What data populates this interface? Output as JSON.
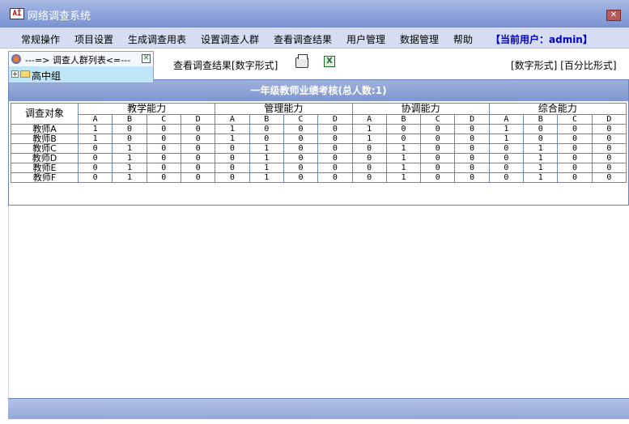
{
  "window": {
    "title": "网络调查系统",
    "icon_text": "Aİ"
  },
  "menu": {
    "items": [
      "常规操作",
      "项目设置",
      "生成调查用表",
      "设置调查人群",
      "查看调查结果",
      "用户管理",
      "数据管理",
      "帮助"
    ],
    "current_user": "【当前用户：admin】"
  },
  "group_panel": {
    "title": "---=> 调查人群列表<=---",
    "tree_item": "高中组"
  },
  "toolbar": {
    "view_label": "查看调查结果[数字形式]",
    "format_number": "[数字形式]",
    "format_percent": "[百分比形式]"
  },
  "table": {
    "title": "一年级教师业绩考核(总人数:1)",
    "object_header": "调查对象",
    "categories": [
      "教学能力",
      "管理能力",
      "协调能力",
      "综合能力"
    ],
    "grades": [
      "A",
      "B",
      "C",
      "D"
    ],
    "rows": [
      {
        "name": "教师A",
        "values": [
          1,
          0,
          0,
          0,
          1,
          0,
          0,
          0,
          1,
          0,
          0,
          0,
          1,
          0,
          0,
          0
        ]
      },
      {
        "name": "教师B",
        "values": [
          1,
          0,
          0,
          0,
          1,
          0,
          0,
          0,
          1,
          0,
          0,
          0,
          1,
          0,
          0,
          0
        ]
      },
      {
        "name": "教师C",
        "values": [
          0,
          1,
          0,
          0,
          0,
          1,
          0,
          0,
          0,
          1,
          0,
          0,
          0,
          1,
          0,
          0
        ]
      },
      {
        "name": "教师D",
        "values": [
          0,
          1,
          0,
          0,
          0,
          1,
          0,
          0,
          0,
          1,
          0,
          0,
          0,
          1,
          0,
          0
        ]
      },
      {
        "name": "教师E",
        "values": [
          0,
          1,
          0,
          0,
          0,
          1,
          0,
          0,
          0,
          1,
          0,
          0,
          0,
          1,
          0,
          0
        ]
      },
      {
        "name": "教师F",
        "values": [
          0,
          1,
          0,
          0,
          0,
          1,
          0,
          0,
          0,
          1,
          0,
          0,
          0,
          1,
          0,
          0
        ]
      }
    ]
  },
  "icons": {
    "app": "app-icon",
    "close": "close-icon",
    "group": "user-group-icon",
    "folder": "folder-icon",
    "print": "printer-icon",
    "excel": "excel-icon"
  },
  "colors": {
    "titlebar": "#8ea4dc",
    "menubar": "#d6ddf2",
    "user_text": "#0000c8",
    "table_border": "#6a86b6",
    "tree_selected": "#bfe6f6"
  }
}
